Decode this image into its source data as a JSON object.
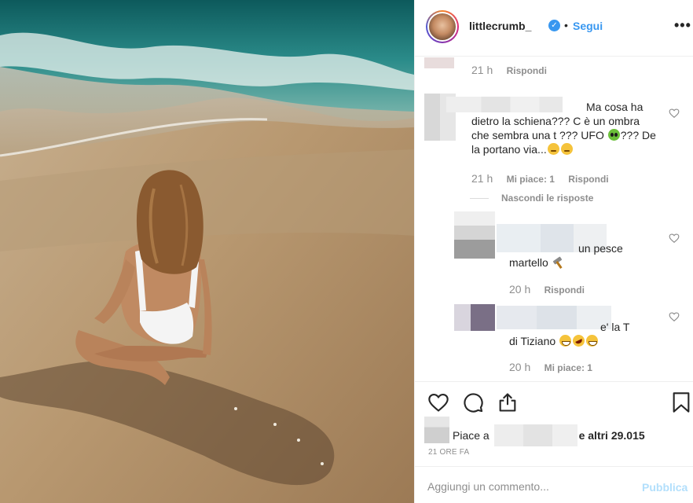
{
  "post": {
    "username": "littlecrumb_",
    "follow_label": "Segui",
    "separator": "•",
    "verified_glyph": "✓",
    "more_glyph": "•••"
  },
  "comments": [
    {
      "meta_time": "21 h",
      "meta_reply": "Rispondi"
    },
    {
      "text": "Ma cosa ha dietro la schiena??? C è un ombra che sembra una t ??? UFO",
      "text_mid": "???",
      "text_end": "De la portano via...",
      "meta_time": "21 h",
      "meta_likes": "Mi piace: 1",
      "meta_reply": "Rispondi"
    }
  ],
  "hide_replies_label": "Nascondi le risposte",
  "replies": [
    {
      "text_a": "un pesce",
      "text_b": "martello",
      "meta_time": "20 h",
      "meta_reply": "Rispondi"
    },
    {
      "text_a": "e' la T",
      "text_b": "di Tiziano",
      "meta_time": "20 h",
      "meta_likes": "Mi piace: 1"
    }
  ],
  "likes": {
    "prefix": "Piace a",
    "suffix": "e altri 29.015"
  },
  "time_ago": "21 ORE FA",
  "add_comment": {
    "placeholder": "Aggiungi un commento...",
    "publish_label": "Pubblica"
  },
  "icons": {
    "like": "heart-icon",
    "comment": "comment-icon",
    "share": "share-icon",
    "save": "bookmark-icon"
  },
  "colors": {
    "link_blue": "#3897f0",
    "muted": "#8e8e8e",
    "publish_disabled": "#b2dffc"
  }
}
